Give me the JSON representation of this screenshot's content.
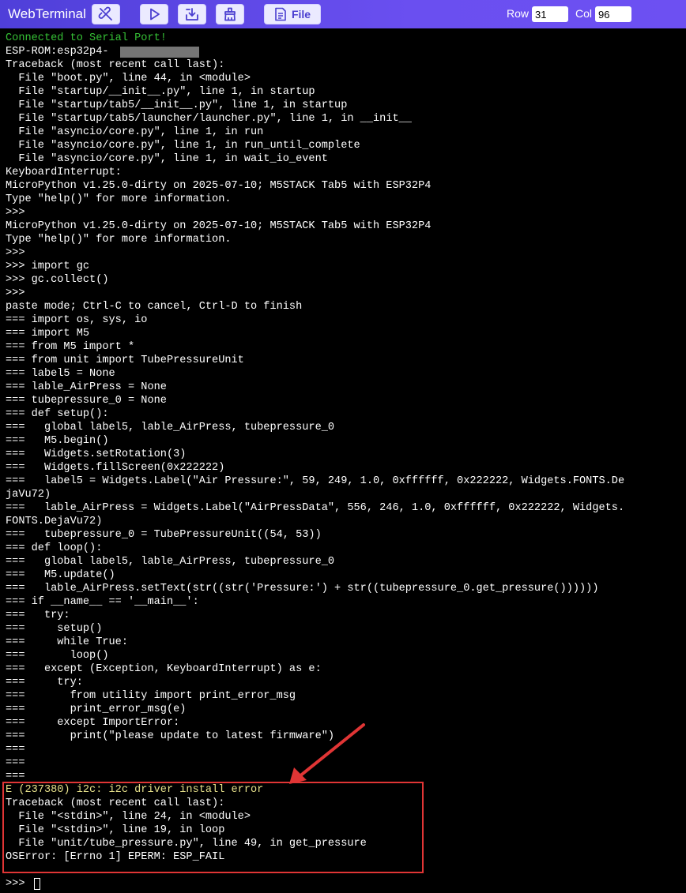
{
  "app": {
    "title": "WebTerminal"
  },
  "toolbar": {
    "buttons": [
      {
        "name": "disconnect-button",
        "icon": "link-broken-icon"
      },
      {
        "name": "run-button",
        "icon": "play-icon"
      },
      {
        "name": "download-button",
        "icon": "download-tray-icon"
      },
      {
        "name": "erase-button",
        "icon": "eraser-icon"
      }
    ],
    "file_label": "File",
    "file_icon": "file-document-icon",
    "row_label": "Row",
    "row_value": "31",
    "col_label": "Col",
    "col_value": "96"
  },
  "colors": {
    "titlebar": "#5b46e0",
    "terminal_bg": "#000000",
    "terminal_text": "#ffffff",
    "status_green": "#35c035",
    "error_yellow": "#e6e08a",
    "highlight_red": "#e03535"
  },
  "terminal": {
    "lines": [
      {
        "text": "Connected to Serial Port!",
        "style": "green"
      },
      {
        "text": "ESP-ROM:esp32p4-",
        "style": "normal"
      },
      {
        "text": "Traceback (most recent call last):",
        "style": "normal"
      },
      {
        "text": "  File \"boot.py\", line 44, in <module>",
        "style": "normal"
      },
      {
        "text": "  File \"startup/__init__.py\", line 1, in startup",
        "style": "normal"
      },
      {
        "text": "  File \"startup/tab5/__init__.py\", line 1, in startup",
        "style": "normal"
      },
      {
        "text": "  File \"startup/tab5/launcher/launcher.py\", line 1, in __init__",
        "style": "normal"
      },
      {
        "text": "  File \"asyncio/core.py\", line 1, in run",
        "style": "normal"
      },
      {
        "text": "  File \"asyncio/core.py\", line 1, in run_until_complete",
        "style": "normal"
      },
      {
        "text": "  File \"asyncio/core.py\", line 1, in wait_io_event",
        "style": "normal"
      },
      {
        "text": "KeyboardInterrupt:",
        "style": "normal"
      },
      {
        "text": "MicroPython v1.25.0-dirty on 2025-07-10; M5STACK Tab5 with ESP32P4",
        "style": "normal"
      },
      {
        "text": "Type \"help()\" for more information.",
        "style": "normal"
      },
      {
        "text": ">>>",
        "style": "normal"
      },
      {
        "text": "MicroPython v1.25.0-dirty on 2025-07-10; M5STACK Tab5 with ESP32P4",
        "style": "normal"
      },
      {
        "text": "Type \"help()\" for more information.",
        "style": "normal"
      },
      {
        "text": ">>>",
        "style": "normal"
      },
      {
        "text": ">>> import gc",
        "style": "normal"
      },
      {
        "text": ">>> gc.collect()",
        "style": "normal"
      },
      {
        "text": ">>>",
        "style": "normal"
      },
      {
        "text": "paste mode; Ctrl-C to cancel, Ctrl-D to finish",
        "style": "normal"
      },
      {
        "text": "=== import os, sys, io",
        "style": "normal"
      },
      {
        "text": "=== import M5",
        "style": "normal"
      },
      {
        "text": "=== from M5 import *",
        "style": "normal"
      },
      {
        "text": "=== from unit import TubePressureUnit",
        "style": "normal"
      },
      {
        "text": "=== label5 = None",
        "style": "normal"
      },
      {
        "text": "=== lable_AirPress = None",
        "style": "normal"
      },
      {
        "text": "=== tubepressure_0 = None",
        "style": "normal"
      },
      {
        "text": "=== def setup():",
        "style": "normal"
      },
      {
        "text": "===   global label5, lable_AirPress, tubepressure_0",
        "style": "normal"
      },
      {
        "text": "===   M5.begin()",
        "style": "normal"
      },
      {
        "text": "===   Widgets.setRotation(3)",
        "style": "normal"
      },
      {
        "text": "===   Widgets.fillScreen(0x222222)",
        "style": "normal"
      },
      {
        "text": "===   label5 = Widgets.Label(\"Air Pressure:\", 59, 249, 1.0, 0xffffff, 0x222222, Widgets.FONTS.De",
        "style": "normal"
      },
      {
        "text": "jaVu72)",
        "style": "normal"
      },
      {
        "text": "===   lable_AirPress = Widgets.Label(\"AirPressData\", 556, 246, 1.0, 0xffffff, 0x222222, Widgets.",
        "style": "normal"
      },
      {
        "text": "FONTS.DejaVu72)",
        "style": "normal"
      },
      {
        "text": "===   tubepressure_0 = TubePressureUnit((54, 53))",
        "style": "normal"
      },
      {
        "text": "=== def loop():",
        "style": "normal"
      },
      {
        "text": "===   global label5, lable_AirPress, tubepressure_0",
        "style": "normal"
      },
      {
        "text": "===   M5.update()",
        "style": "normal"
      },
      {
        "text": "===   lable_AirPress.setText(str((str('Pressure:') + str((tubepressure_0.get_pressure())))))",
        "style": "normal"
      },
      {
        "text": "=== if __name__ == '__main__':",
        "style": "normal"
      },
      {
        "text": "===   try:",
        "style": "normal"
      },
      {
        "text": "===     setup()",
        "style": "normal"
      },
      {
        "text": "===     while True:",
        "style": "normal"
      },
      {
        "text": "===       loop()",
        "style": "normal"
      },
      {
        "text": "===   except (Exception, KeyboardInterrupt) as e:",
        "style": "normal"
      },
      {
        "text": "===     try:",
        "style": "normal"
      },
      {
        "text": "===       from utility import print_error_msg",
        "style": "normal"
      },
      {
        "text": "===       print_error_msg(e)",
        "style": "normal"
      },
      {
        "text": "===     except ImportError:",
        "style": "normal"
      },
      {
        "text": "===       print(\"please update to latest firmware\")",
        "style": "normal"
      },
      {
        "text": "===",
        "style": "normal"
      },
      {
        "text": "===",
        "style": "normal"
      },
      {
        "text": "===",
        "style": "normal"
      },
      {
        "text": "E (237380) i2c: i2c driver install error",
        "style": "yellow"
      },
      {
        "text": "Traceback (most recent call last):",
        "style": "normal"
      },
      {
        "text": "  File \"<stdin>\", line 24, in <module>",
        "style": "normal"
      },
      {
        "text": "  File \"<stdin>\", line 19, in loop",
        "style": "normal"
      },
      {
        "text": "  File \"unit/tube_pressure.py\", line 49, in get_pressure",
        "style": "normal"
      },
      {
        "text": "OSError: [Errno 1] EPERM: ESP_FAIL",
        "style": "normal"
      },
      {
        "text": "",
        "style": "normal"
      },
      {
        "text": ">>> ",
        "style": "normal"
      }
    ]
  }
}
